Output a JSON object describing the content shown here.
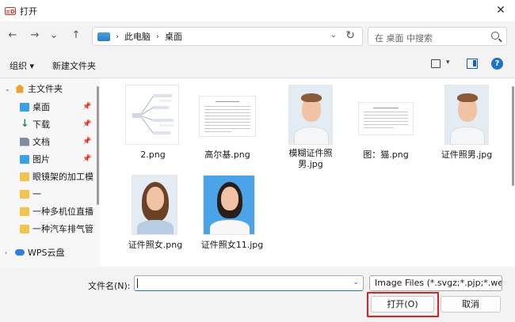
{
  "window": {
    "title": "打开",
    "app_icon_text": "≡D",
    "close_glyph": "✕"
  },
  "nav": {
    "back": "←",
    "forward": "→",
    "recent": "⌄",
    "up": "↑",
    "breadcrumb": [
      "此电脑",
      "桌面"
    ],
    "separator": "›",
    "dropdown": "⌄",
    "refresh": "↻",
    "search_placeholder": "在 桌面 中搜索"
  },
  "toolbar": {
    "organize": "组织 ▾",
    "new_folder": "新建文件夹",
    "view_dropdown": "▾",
    "help": "?"
  },
  "sidebar": {
    "items": [
      {
        "label": "主文件夹",
        "icon": "home-icon",
        "expanded": true
      },
      {
        "label": "桌面",
        "icon": "desktop-icon",
        "pinned": true
      },
      {
        "label": "下载",
        "icon": "download-icon",
        "pinned": true
      },
      {
        "label": "文档",
        "icon": "document-icon",
        "pinned": true
      },
      {
        "label": "图片",
        "icon": "picture-icon",
        "pinned": true
      },
      {
        "label": "眼镜架的加工模",
        "icon": "folder-icon"
      },
      {
        "label": "一",
        "icon": "folder-icon"
      },
      {
        "label": "一种多机位直播",
        "icon": "folder-icon"
      },
      {
        "label": "一种汽车排气管",
        "icon": "folder-icon"
      },
      {
        "label": "WPS云盘",
        "icon": "cloud-icon"
      }
    ],
    "pin_glyph": "📌",
    "chevron_open": "⌄",
    "chevron_closed": "›"
  },
  "files": [
    {
      "name": "2.png",
      "kind": "mindmap"
    },
    {
      "name": "高尔基.png",
      "kind": "document"
    },
    {
      "name": "模糊证件照男.jpg",
      "kind": "portrait-male"
    },
    {
      "name": "图：猫.png",
      "kind": "document-small"
    },
    {
      "name": "证件照男.jpg",
      "kind": "portrait-male"
    },
    {
      "name": "证件照女.png",
      "kind": "portrait-female"
    },
    {
      "name": "证件照女11.jpg",
      "kind": "portrait-female-blue"
    }
  ],
  "footer": {
    "filename_label": "文件名(N):",
    "filename_value": "",
    "filter": "Image Files (*.svgz;*.pjp;*.we",
    "open": "打开(O)",
    "cancel": "取消",
    "highlight_color": "#e02020"
  }
}
